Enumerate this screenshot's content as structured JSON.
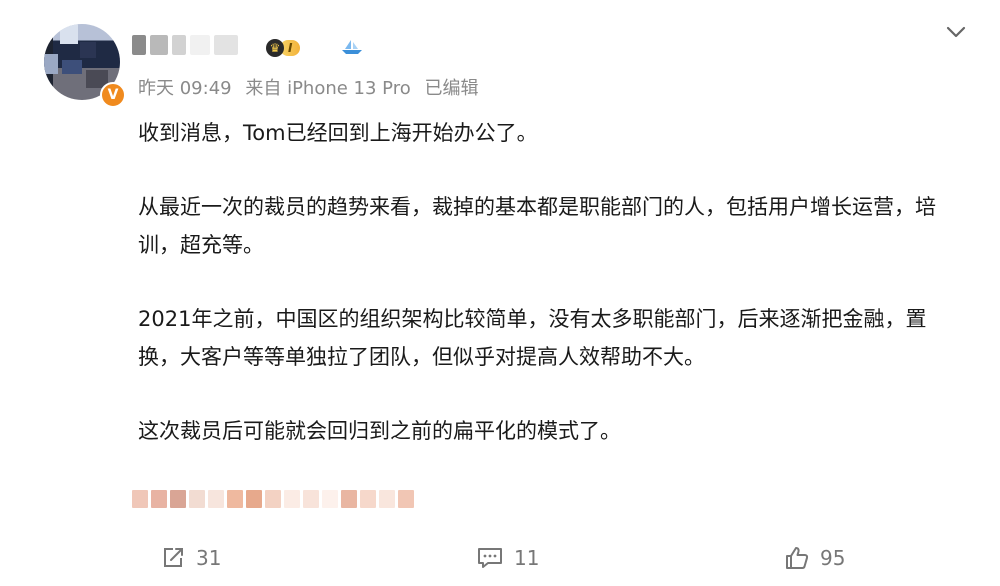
{
  "post": {
    "meta": {
      "time": "昨天 09:49",
      "source": "来自 iPhone 13 Pro",
      "edited": "已编辑"
    },
    "badges": {
      "vip_level": "I",
      "verify": "V"
    },
    "paragraphs": [
      "收到消息，Tom已经回到上海开始办公了。",
      "从最近一次的裁员的趋势来看，裁掉的基本都是职能部门的人，包括用户增长运营，培训，超充等。",
      "2021年之前，中国区的组织架构比较简单，没有太多职能部门，后来逐渐把金融，置换，大客户等等单独拉了团队，但似乎对提高人效帮助不大。",
      "这次裁员后可能就会回归到之前的扁平化的模式了。"
    ],
    "actions": {
      "repost_count": "31",
      "comment_count": "11",
      "like_count": "95"
    },
    "icons": {
      "more": "chevron-down-icon",
      "repost": "share-icon",
      "comment": "comment-icon",
      "like": "thumbs-up-icon"
    },
    "colors": {
      "accent_verify": "#f08a1e",
      "meta_text": "#8a8a8a",
      "action_text": "#777777"
    }
  }
}
